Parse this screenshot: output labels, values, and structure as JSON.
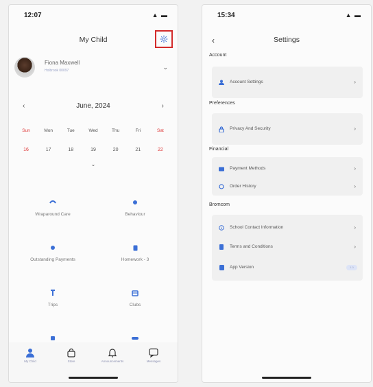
{
  "left": {
    "status_time": "12:07",
    "status_icons": "▲ ▬",
    "title": "My Child",
    "child": {
      "name": "Fiona Maxwell",
      "subtitle": "Holbrook 00097"
    },
    "calendar": {
      "month": "June, 2024",
      "prev": "‹",
      "next": "›",
      "expand": "⌄",
      "days": [
        "Sun",
        "Mon",
        "Tue",
        "Wed",
        "Thu",
        "Fri",
        "Sat"
      ],
      "dates": [
        "16",
        "17",
        "18",
        "19",
        "20",
        "21",
        "22"
      ]
    },
    "tiles": [
      {
        "label": "Wraparound Care",
        "icon": "wraparound-icon"
      },
      {
        "label": "Behaviour",
        "icon": "behaviour-icon"
      },
      {
        "label": "Outstanding Payments",
        "icon": "payments-icon"
      },
      {
        "label": "Homework - 3",
        "icon": "homework-icon"
      },
      {
        "label": "Trips",
        "icon": "trips-icon"
      },
      {
        "label": "Clubs",
        "icon": "clubs-icon"
      },
      {
        "label": "",
        "icon": "more-icon"
      },
      {
        "label": "",
        "icon": "more-icon"
      }
    ],
    "nav": [
      {
        "label": "My Child",
        "icon": "person-icon"
      },
      {
        "label": "Store",
        "icon": "bag-icon"
      },
      {
        "label": "Announcements",
        "icon": "bell-icon"
      },
      {
        "label": "Messages",
        "icon": "chat-icon"
      }
    ],
    "colors": {
      "accent": "#3b6fd6",
      "weekend": "#d33333",
      "highlight_box": "#d32a2a"
    }
  },
  "right": {
    "status_time": "15:34",
    "status_icons": "▲ ▬",
    "title": "Settings",
    "back": "‹",
    "sections": [
      {
        "title": "Account",
        "items": [
          {
            "label": "Account Settings",
            "icon": "user-icon"
          }
        ]
      },
      {
        "title": "Preferences",
        "items": [
          {
            "label": "Privacy And Security",
            "icon": "lock-icon"
          }
        ]
      },
      {
        "title": "Financial",
        "items": [
          {
            "label": "Payment Methods",
            "icon": "card-icon"
          },
          {
            "label": "Order History",
            "icon": "history-icon"
          }
        ]
      },
      {
        "title": "Bromcom",
        "items": [
          {
            "label": "School Contact Information",
            "icon": "info-icon"
          },
          {
            "label": "Terms and Conditions",
            "icon": "document-icon"
          },
          {
            "label": "App Version",
            "icon": "phone-icon",
            "value": "1.0"
          }
        ]
      }
    ]
  }
}
